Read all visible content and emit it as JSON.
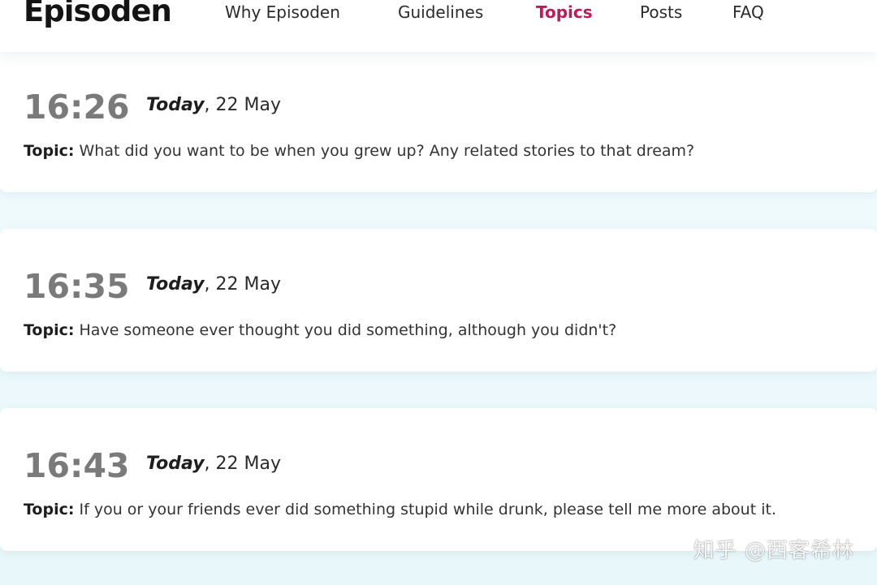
{
  "header": {
    "logo": "Episoden",
    "nav": [
      {
        "label": "Why Episoden",
        "active": false
      },
      {
        "label": "Guidelines",
        "active": false
      },
      {
        "label": "Topics",
        "active": true
      },
      {
        "label": "Posts",
        "active": false
      },
      {
        "label": "FAQ",
        "active": false
      }
    ]
  },
  "topic_label": "Topic:",
  "entries": [
    {
      "time": "16:26",
      "day": "Today",
      "date_rest": ", 22 May",
      "topic": "What did you want to be when you grew up? Any related stories to that dream?"
    },
    {
      "time": "16:35",
      "day": "Today",
      "date_rest": ", 22 May",
      "topic": "Have someone ever thought you did something, although you didn't?"
    },
    {
      "time": "16:43",
      "day": "Today",
      "date_rest": ", 22 May",
      "topic": "If you or your friends ever did something stupid while drunk, please tell me more about it."
    }
  ],
  "watermark": "知乎 @西客希林",
  "colors": {
    "accent": "#c0185a",
    "time_gray": "#7a7a7a",
    "background": "#eef9fb"
  }
}
